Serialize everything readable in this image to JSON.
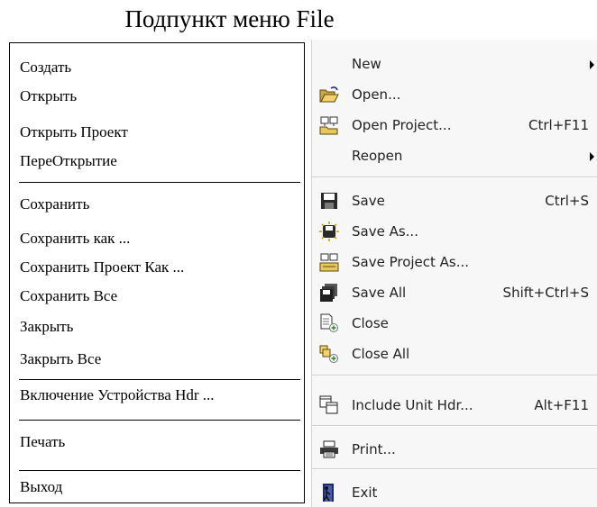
{
  "caption": "Подпункт меню File",
  "ru_menu": {
    "items": [
      {
        "label": "Создать"
      },
      {
        "label": "Открыть"
      },
      {
        "label": "Открыть Проект"
      },
      {
        "label": "ПереОткрытие"
      },
      {
        "label": "Сохранить"
      },
      {
        "label": "Сохранить как ..."
      },
      {
        "label": "Сохранить Проект Как ..."
      },
      {
        "label": "Сохранить Все"
      },
      {
        "label": "Закрыть"
      },
      {
        "label": "Закрыть Все"
      },
      {
        "label": "Включение Устройства  Hdr ..."
      },
      {
        "label": "Печать"
      },
      {
        "label": "Выход"
      }
    ]
  },
  "en_menu": {
    "items": [
      {
        "label": "New",
        "shortcut": "",
        "icon": "none",
        "submenu": true
      },
      {
        "label": "Open...",
        "shortcut": "",
        "icon": "open-folder-icon"
      },
      {
        "label": "Open Project...",
        "shortcut": "Ctrl+F11",
        "icon": "open-project-icon"
      },
      {
        "label": "Reopen",
        "shortcut": "",
        "icon": "none",
        "submenu": true
      },
      {
        "label": "Save",
        "shortcut": "Ctrl+S",
        "icon": "floppy-disk-icon"
      },
      {
        "label": "Save As...",
        "shortcut": "",
        "icon": "save-as-icon"
      },
      {
        "label": "Save Project As...",
        "shortcut": "",
        "icon": "save-project-as-icon"
      },
      {
        "label": "Save All",
        "shortcut": "Shift+Ctrl+S",
        "icon": "save-all-icon"
      },
      {
        "label": "Close",
        "shortcut": "",
        "icon": "close-document-icon"
      },
      {
        "label": "Close All",
        "shortcut": "",
        "icon": "close-all-icon"
      },
      {
        "label": "Include Unit Hdr...",
        "shortcut": "Alt+F11",
        "icon": "include-unit-icon"
      },
      {
        "label": "Print...",
        "shortcut": "",
        "icon": "printer-icon"
      },
      {
        "label": "Exit",
        "shortcut": "",
        "icon": "exit-door-icon"
      }
    ]
  }
}
